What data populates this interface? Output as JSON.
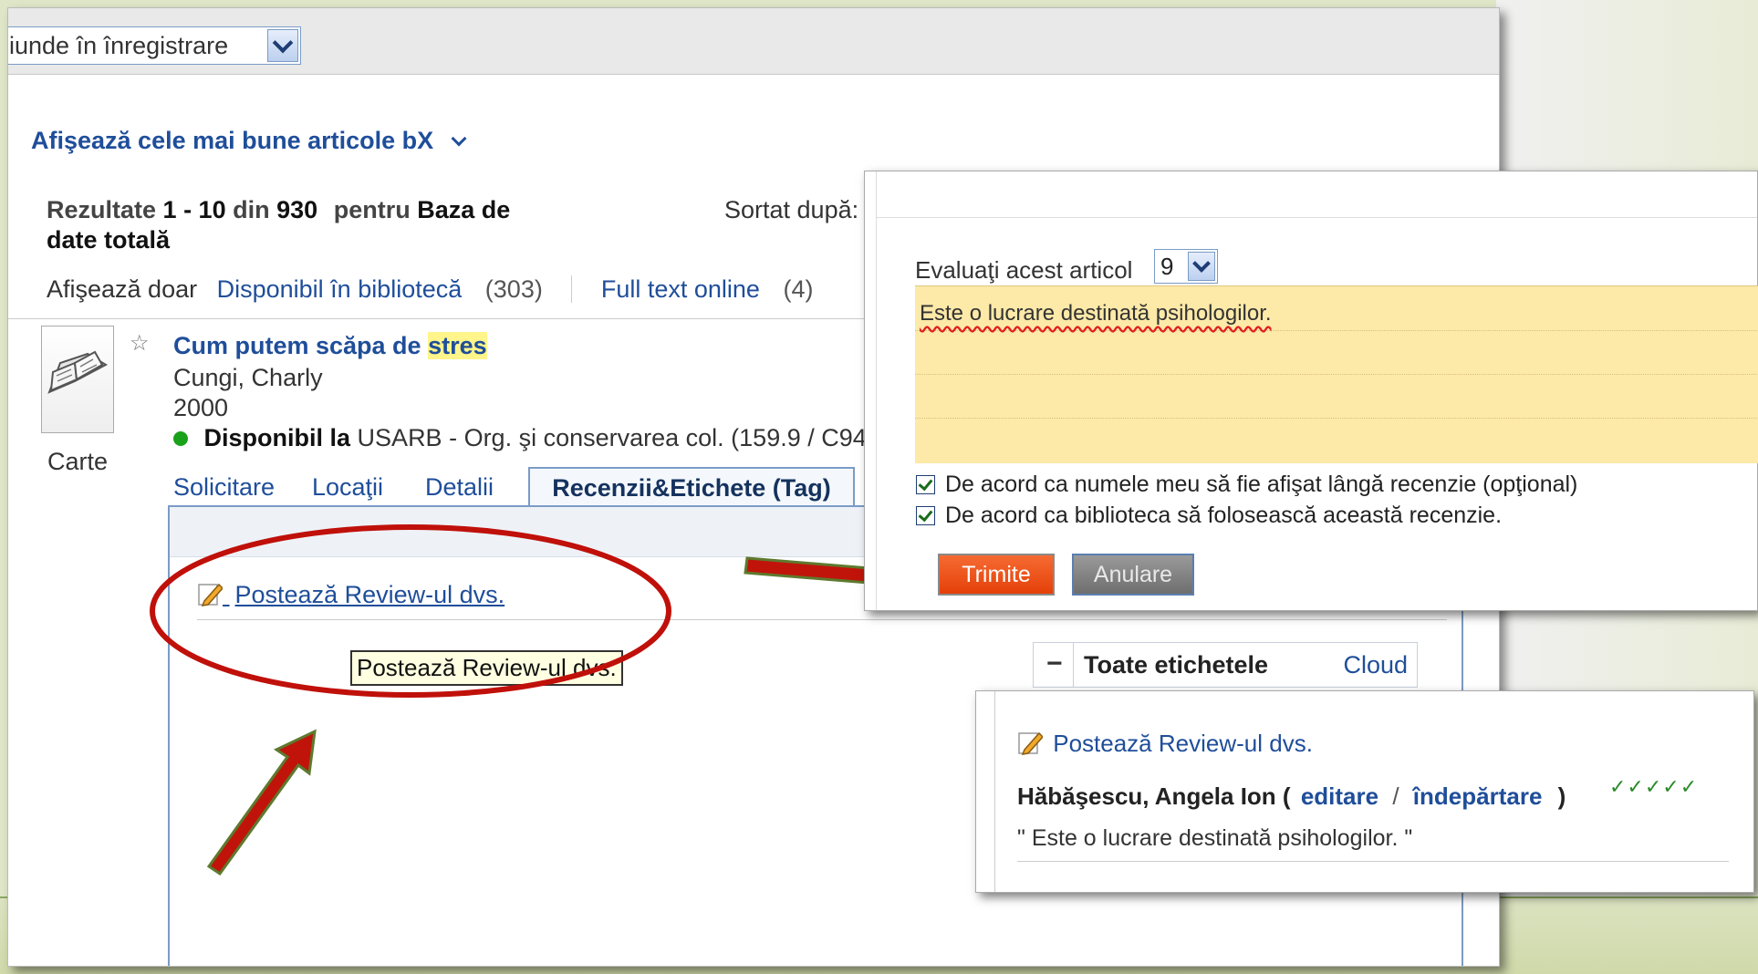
{
  "colors": {
    "link": "#1f4e9a",
    "submit": "#ee4a12",
    "cancel": "#7d7d7d",
    "review_area": "#fde9a8",
    "available_dot": "#1aa11a",
    "annotation": "#c0100a"
  },
  "search_scope": {
    "value": "iunde în înregistrare"
  },
  "best_articles": {
    "label": "Afişează cele mai bune articole bX"
  },
  "results": {
    "prefix": "Rezultate",
    "range": "1 - 10",
    "of": "din",
    "total": "930",
    "for": "pentru",
    "database_line1": "Baza de",
    "database_line2": "date totală"
  },
  "sort": {
    "label": "Sortat după:"
  },
  "filters": {
    "label": "Afişează doar",
    "items": [
      {
        "label": "Disponibil în bibliotecă",
        "count": "(303)"
      },
      {
        "label": "Full text online",
        "count": "(4)"
      }
    ]
  },
  "record": {
    "title_main": "Cum putem scăpa de",
    "title_highlight": "stres",
    "author": "Cungi, Charly",
    "year": "2000",
    "availability_bold": "Disponibil la",
    "availability_text": "USARB - Org. şi conservarea col.  (159.9 / C94",
    "type": "Carte"
  },
  "tabs": [
    "Solicitare",
    "Locaţii",
    "Detalii",
    "Recenzii&Etichete (Tag)"
  ],
  "post_review": {
    "label": "Postează Review-ul dvs.",
    "tooltip": "Postează Review-ul dvs."
  },
  "tags_box": {
    "title": "Toate etichetele",
    "cloud": "Cloud",
    "collapse": "−"
  },
  "rate_dialog": {
    "label": "Evaluaţi acest articol",
    "rating": "9",
    "review_text": "Este o lucrare destinată psihologilor.",
    "consent_name": "De acord ca numele meu să fie afişat lângă recenzie (opţional)",
    "consent_library": "De acord ca biblioteca să folosească această recenzie.",
    "submit": "Trimite",
    "cancel": "Anulare"
  },
  "posted_review": {
    "post_link": "Postează Review-ul dvs.",
    "author": "Hăbăşescu, Angela Ion",
    "open_paren": "(",
    "edit": "editare",
    "sep": "/",
    "remove": "îndepărtare",
    "close_paren": ")",
    "rating_marks": "✓✓✓✓✓",
    "text": "\" Este o lucrare destinată psihologilor. \""
  }
}
